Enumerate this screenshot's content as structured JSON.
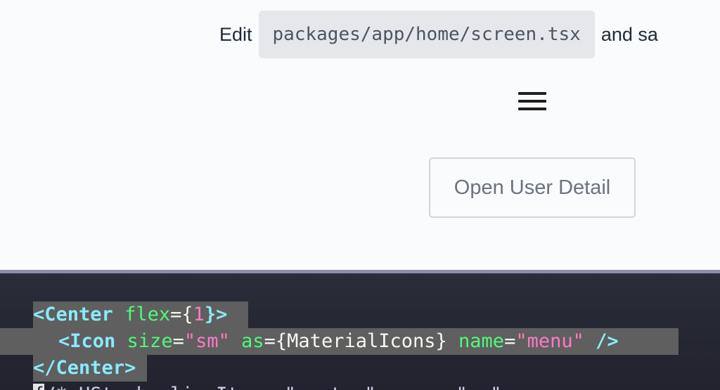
{
  "app": {
    "edit_prefix": "Edit",
    "edit_path": "packages/app/home/screen.tsx",
    "edit_suffix": "and sa",
    "menu_icon": "hamburger-menu-icon",
    "open_user_detail_label": "Open User Detail"
  },
  "editor": {
    "line1": {
      "open": "<Center",
      "attr": "flex",
      "eq": "={",
      "num": "1",
      "close": "}>"
    },
    "line2": {
      "open": "<Icon",
      "attr_size": "size",
      "eq1": "=",
      "val_size": "\"sm\"",
      "attr_as": "as",
      "eq2": "={",
      "val_as": "MaterialIcons",
      "brace_close": "}",
      "attr_name": "name",
      "eq3": "=",
      "val_name": "\"menu\"",
      "self_close": "/>"
    },
    "line3": {
      "close_tag": "</Center>"
    },
    "line4": {
      "cursor": "{",
      "rest": "/* HStack alignItems=\"center\" space=\"sm\">"
    }
  },
  "colors": {
    "preview_bg": "#f9fbfd",
    "editor_bg": "#262834",
    "selection": "#5e5f5e",
    "tag": "#8be9fd",
    "attr": "#50fa7b",
    "string": "#ff79c6"
  }
}
